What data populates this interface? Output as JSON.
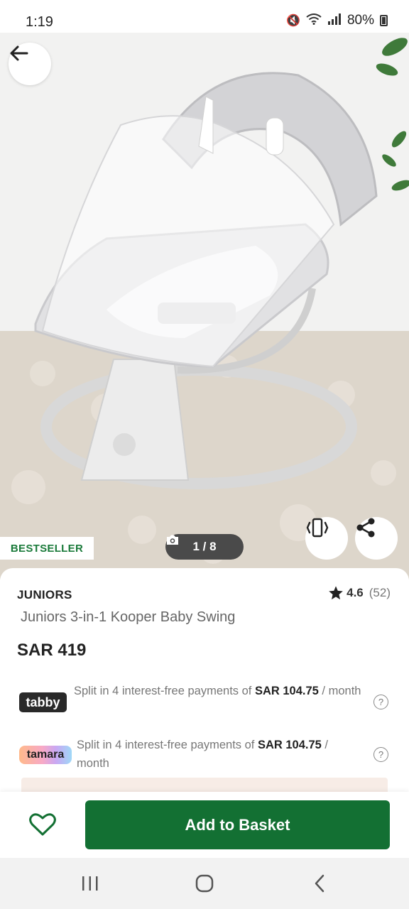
{
  "status_bar": {
    "time": "1:19",
    "battery": "80%"
  },
  "hero": {
    "badge": "BESTSELLER",
    "image_counter": "1 / 8"
  },
  "product": {
    "brand": "JUNIORS",
    "rating": "4.6",
    "review_count": "(52)",
    "title": "Juniors 3-in-1 Kooper Baby Swing",
    "price": "SAR 419"
  },
  "bnpl": {
    "tabby": {
      "logo": "tabby",
      "text_prefix": "Split in 4 interest-free payments of ",
      "amount": "SAR 104.75",
      "suffix": " / month"
    },
    "tamara": {
      "logo": "tamara",
      "text_prefix": "Split in 4 interest-free payments of ",
      "amount": "SAR 104.75",
      "suffix": " / month"
    },
    "help_glyph": "?"
  },
  "actions": {
    "add_to_basket": "Add to Basket"
  },
  "icons": {
    "back": "arrow-left-icon",
    "camera": "camera-icon",
    "view_3d": "device-rotate-icon",
    "share": "share-icon",
    "wishlist": "heart-icon",
    "star": "star-icon"
  },
  "colors": {
    "accent_green": "#137033",
    "bestseller_green": "#1a7a3a"
  }
}
